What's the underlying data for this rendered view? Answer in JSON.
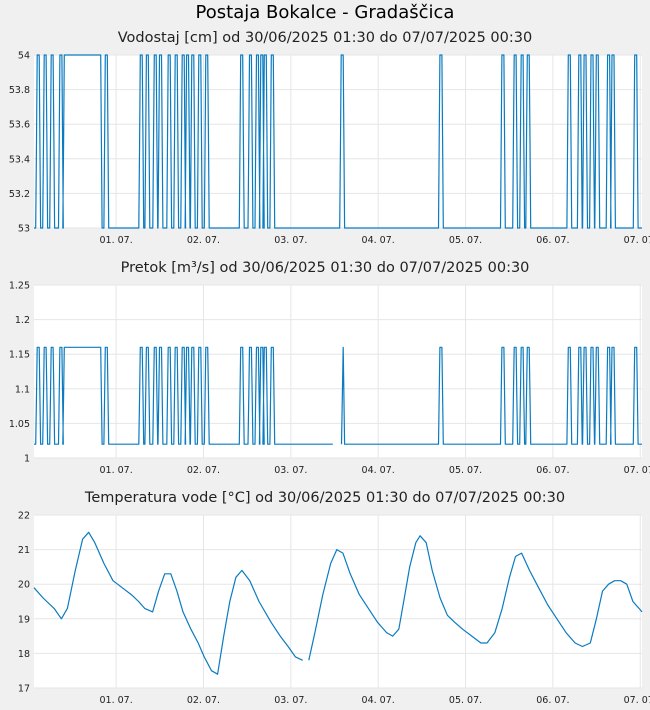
{
  "page": {
    "title": "Postaja Bokalce - Gradaščica"
  },
  "colors": {
    "series": "#0a7bc0",
    "grid": "#e6e6e6",
    "plot_bg": "#ffffff",
    "page_bg": "#f0f0f0"
  },
  "chart_data": [
    {
      "type": "line",
      "title": "Vodostaj [cm] od 30/06/2025 01:30 do 07/07/2025 00:30",
      "xlabel": "",
      "ylabel": "",
      "xlim": [
        0,
        6.96
      ],
      "ylim": [
        53,
        54
      ],
      "yticks": [
        53,
        53.2,
        53.4,
        53.6,
        53.8,
        54
      ],
      "ytick_labels": [
        "53",
        "53.2",
        "53.4",
        "53.6",
        "53.8",
        "54"
      ],
      "xticks": [
        0.94,
        1.94,
        2.94,
        3.94,
        4.94,
        5.94,
        6.94
      ],
      "xtick_labels": [
        "01. 07.",
        "02. 07.",
        "03. 07.",
        "04. 07.",
        "05. 07.",
        "06. 07.",
        "07. 07."
      ],
      "grid": true,
      "pulse_low": 53,
      "pulse_high": 54,
      "plateaus": [
        [
          0.33,
          0.78
        ]
      ],
      "pulses": [
        0.02,
        0.1,
        0.18,
        0.28,
        0.8,
        1.2,
        1.27,
        1.36,
        1.42,
        1.52,
        1.6,
        1.68,
        1.73,
        1.79,
        1.87,
        1.95,
        2.35,
        2.45,
        2.53,
        2.58,
        2.62,
        2.7,
        3.5,
        4.63,
        5.34,
        5.48,
        5.56,
        5.63,
        6.1,
        6.22,
        6.28,
        6.36,
        6.42,
        6.55,
        6.6,
        6.86
      ]
    },
    {
      "type": "line",
      "title": "Pretok [m³/s] od 30/06/2025 01:30 do 07/07/2025 00:30",
      "xlabel": "",
      "ylabel": "",
      "xlim": [
        0,
        6.96
      ],
      "ylim": [
        1,
        1.25
      ],
      "yticks": [
        1,
        1.05,
        1.1,
        1.15,
        1.2,
        1.25
      ],
      "ytick_labels": [
        "1",
        "1.05",
        "1.1",
        "1.15",
        "1.2",
        "1.25"
      ],
      "xticks": [
        0.94,
        1.94,
        2.94,
        3.94,
        4.94,
        5.94,
        6.94
      ],
      "xtick_labels": [
        "01. 07.",
        "02. 07.",
        "03. 07.",
        "04. 07.",
        "05. 07.",
        "06. 07.",
        "07. 07."
      ],
      "grid": true,
      "pulse_low": 1.02,
      "pulse_high": 1.16,
      "plateaus": [
        [
          0.33,
          0.78
        ]
      ],
      "pulses": [
        0.02,
        0.1,
        0.18,
        0.28,
        0.8,
        1.2,
        1.27,
        1.36,
        1.42,
        1.52,
        1.6,
        1.68,
        1.73,
        1.79,
        1.87,
        1.95,
        2.35,
        2.45,
        2.53,
        2.58,
        2.62,
        2.7,
        3.5,
        4.63,
        5.34,
        5.48,
        5.56,
        5.63,
        6.1,
        6.22,
        6.28,
        6.36,
        6.42,
        6.55,
        6.6,
        6.86
      ]
    },
    {
      "type": "line",
      "title": "Temperatura vode [°C] od 30/06/2025 01:30 do 07/07/2025 00:30",
      "xlabel": "",
      "ylabel": "",
      "xlim": [
        0,
        6.96
      ],
      "ylim": [
        17,
        22
      ],
      "yticks": [
        17,
        18,
        19,
        20,
        21,
        22
      ],
      "ytick_labels": [
        "17",
        "18",
        "19",
        "20",
        "21",
        "22"
      ],
      "xticks": [
        0.94,
        1.94,
        2.94,
        3.94,
        4.94,
        5.94,
        6.94
      ],
      "xtick_labels": [
        "01. 07.",
        "02. 07.",
        "03. 07.",
        "04. 07.",
        "05. 07.",
        "06. 07.",
        "07. 07."
      ],
      "grid": true,
      "segments": [
        [
          [
            0,
            19.9
          ],
          [
            0.15,
            19.6
          ],
          [
            0.33,
            19.3
          ],
          [
            0.45,
            19.0
          ],
          [
            0.55,
            19.3
          ],
          [
            0.68,
            20.4
          ],
          [
            0.8,
            21.3
          ],
          [
            0.9,
            21.5
          ],
          [
            1.0,
            21.2
          ],
          [
            1.15,
            20.6
          ],
          [
            1.3,
            20.1
          ],
          [
            1.45,
            19.9
          ],
          [
            1.6,
            19.7
          ],
          [
            1.72,
            19.5
          ],
          [
            1.82,
            19.3
          ],
          [
            1.95,
            19.2
          ],
          [
            2.05,
            19.8
          ],
          [
            2.15,
            20.3
          ],
          [
            2.25,
            20.3
          ],
          [
            2.35,
            19.8
          ],
          [
            2.45,
            19.2
          ],
          [
            2.58,
            18.7
          ],
          [
            2.7,
            18.3
          ],
          [
            2.8,
            17.9
          ],
          [
            2.92,
            17.5
          ],
          [
            3.02,
            17.4
          ],
          [
            3.12,
            18.5
          ],
          [
            3.22,
            19.5
          ],
          [
            3.32,
            20.2
          ],
          [
            3.42,
            20.4
          ],
          [
            3.55,
            20.1
          ],
          [
            3.7,
            19.5
          ],
          [
            3.9,
            18.9
          ],
          [
            4.05,
            18.5
          ],
          [
            4.18,
            18.2
          ],
          [
            4.3,
            17.9
          ],
          [
            4.42,
            17.8
          ]
        ],
        [
          [
            4.52,
            17.8
          ],
          [
            4.62,
            18.6
          ],
          [
            4.75,
            19.7
          ],
          [
            4.88,
            20.6
          ],
          [
            4.98,
            21.0
          ],
          [
            5.08,
            20.9
          ],
          [
            5.2,
            20.3
          ],
          [
            5.35,
            19.7
          ],
          [
            5.5,
            19.3
          ],
          [
            5.65,
            18.9
          ],
          [
            5.8,
            18.6
          ],
          [
            5.9,
            18.5
          ],
          [
            6.0,
            18.7
          ],
          [
            6.08,
            19.5
          ],
          [
            6.18,
            20.5
          ],
          [
            6.28,
            21.2
          ],
          [
            6.35,
            21.4
          ],
          [
            6.45,
            21.2
          ],
          [
            6.55,
            20.4
          ],
          [
            6.68,
            19.6
          ],
          [
            6.8,
            19.1
          ],
          [
            6.92,
            18.9
          ],
          [
            7.05,
            18.7
          ],
          [
            7.2,
            18.5
          ],
          [
            7.35,
            18.3
          ],
          [
            7.45,
            18.3
          ],
          [
            7.58,
            18.6
          ],
          [
            7.7,
            19.3
          ],
          [
            7.82,
            20.2
          ],
          [
            7.92,
            20.8
          ],
          [
            8.02,
            20.9
          ],
          [
            8.15,
            20.4
          ],
          [
            8.3,
            19.9
          ],
          [
            8.45,
            19.4
          ],
          [
            8.6,
            19.0
          ],
          [
            8.75,
            18.6
          ],
          [
            8.9,
            18.3
          ],
          [
            9.02,
            18.2
          ],
          [
            9.15,
            18.3
          ],
          [
            9.25,
            19.0
          ],
          [
            9.35,
            19.8
          ],
          [
            9.45,
            20.0
          ],
          [
            9.55,
            20.1
          ],
          [
            9.65,
            20.1
          ],
          [
            9.75,
            20.0
          ],
          [
            9.85,
            19.5
          ],
          [
            9.95,
            19.3
          ],
          [
            10.0,
            19.2
          ]
        ]
      ]
    }
  ]
}
